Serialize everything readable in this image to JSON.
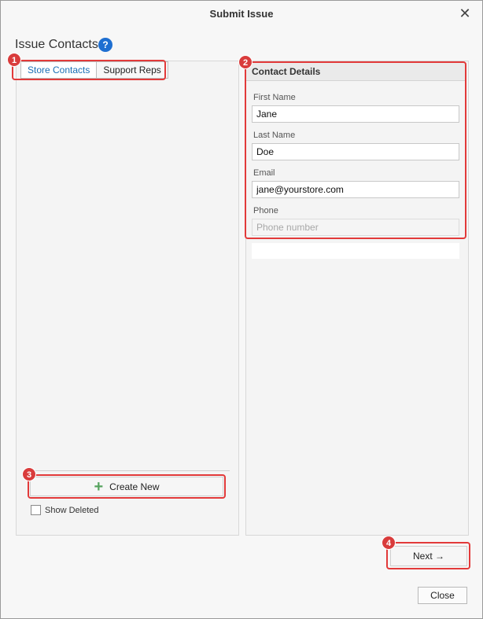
{
  "window": {
    "title": "Submit Issue",
    "close_glyph": "✕"
  },
  "section": {
    "title": "Issue Contacts",
    "help_glyph": "?"
  },
  "tabs": [
    {
      "label": "Store Contacts",
      "active": true
    },
    {
      "label": "Support Reps",
      "active": false
    }
  ],
  "contact_details": {
    "header": "Contact Details",
    "first_name": {
      "label": "First Name",
      "value": "Jane"
    },
    "last_name": {
      "label": "Last Name",
      "value": "Doe"
    },
    "email": {
      "label": "Email",
      "value": "jane@yourstore.com"
    },
    "phone": {
      "label": "Phone",
      "value": "",
      "placeholder": "Phone number"
    }
  },
  "left_panel": {
    "create_label": "Create New",
    "create_icon": "+",
    "show_deleted_label": "Show Deleted",
    "show_deleted_checked": false
  },
  "footer": {
    "next_label": "Next →",
    "close_label": "Close"
  },
  "callouts": [
    "1",
    "2",
    "3",
    "4"
  ],
  "colors": {
    "accent": "#1a6fb5",
    "help": "#1e6fd1",
    "callout": "#e23a3a",
    "plus": "#56a35e"
  }
}
